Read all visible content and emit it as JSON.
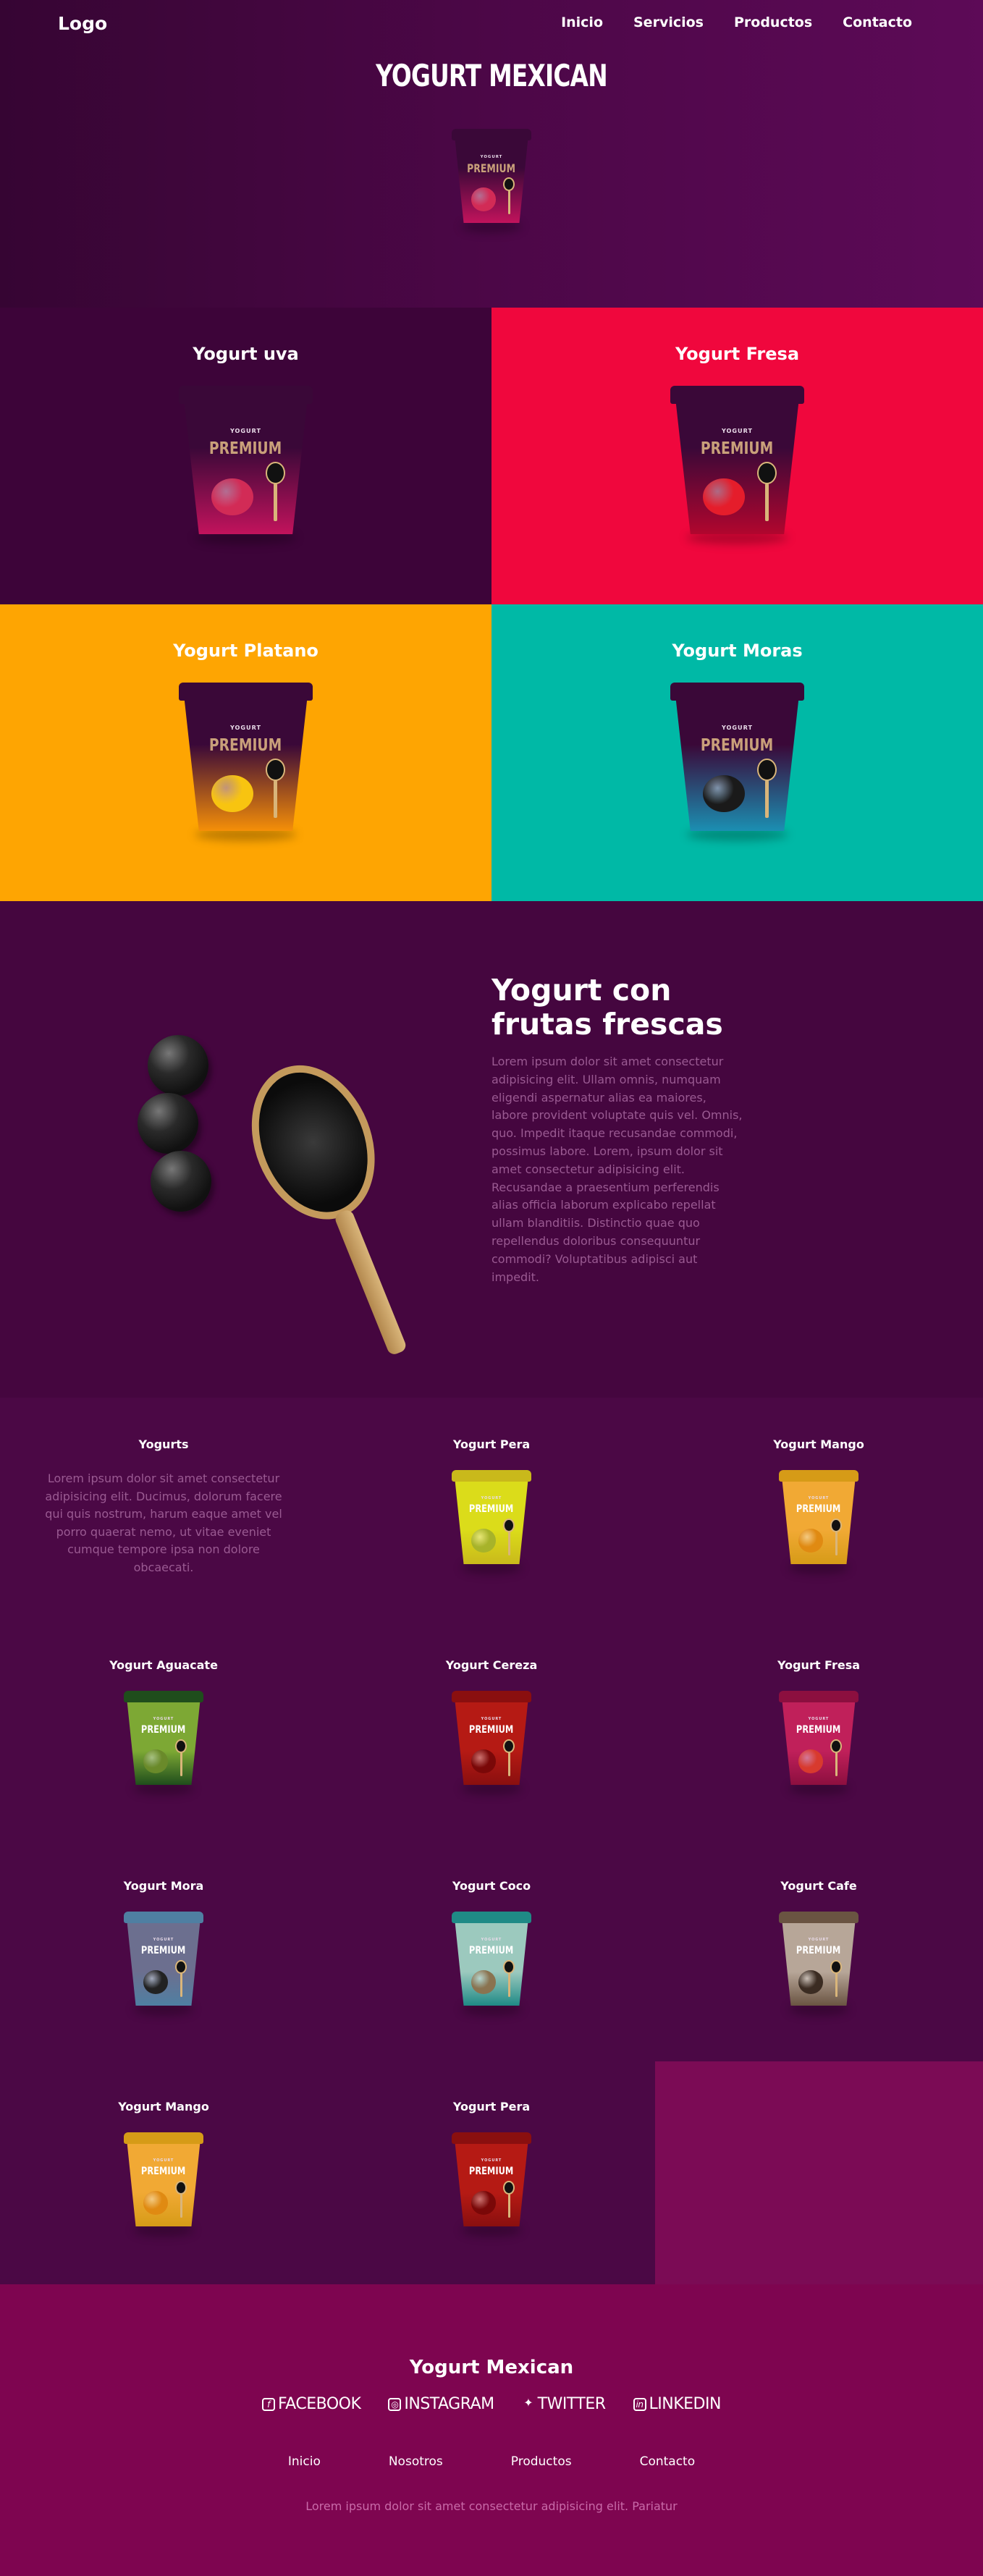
{
  "nav": {
    "logo": "Logo",
    "links": [
      "Inicio",
      "Servicios",
      "Productos",
      "Contacto"
    ]
  },
  "hero": {
    "title": "YOGURT MEXICAN",
    "cup": {
      "brand": "YOGURT",
      "label": "PREMIUM",
      "fruit": "grape-icon"
    }
  },
  "features": [
    {
      "title": "Yogurt uva",
      "bg": "#3d0439",
      "cup_body": "#c2135c",
      "fruit_color": "#d22b56",
      "fruit": "grape-icon"
    },
    {
      "title": "Yogurt Fresa",
      "bg": "#f0073d",
      "cup_body": "#b1062e",
      "fruit_color": "#e51d2b",
      "fruit": "strawberry-icon"
    },
    {
      "title": "Yogurt Platano",
      "bg": "#fea502",
      "cup_body": "#f58f08",
      "fruit_color": "#f8c410",
      "fruit": "banana-icon"
    },
    {
      "title": "Yogurt Moras",
      "bg": "#00b9a6",
      "cup_body": "#1b8fb2",
      "fruit_color": "#1a1a1a",
      "fruit": "blackberry-icon"
    }
  ],
  "cup_labels": {
    "brand": "YOGURT",
    "premium": "PREMIUM"
  },
  "about": {
    "title": "Yogurt con frutas frescas",
    "body": "Lorem ipsum dolor sit amet consectetur adipisicing elit. Ullam omnis, numquam eligendi aspernatur alias ea maiores, labore provident voluptate quis vel. Omnis, quo. Impedit itaque recusandae commodi, possimus labore. Lorem, ipsum dolor sit amet consectetur adipisicing elit. Recusandae a praesentium perferendis alias officia laborum explicabo repellat ullam blanditiis. Distinctio quae quo repellendus doloribus consequuntur commodi? Voluptatibus adipisci aut impedit."
  },
  "products": {
    "intro_title": "Yogurts",
    "intro_text": "Lorem ipsum dolor sit amet consectetur adipisicing elit. Ducimus, dolorum facere qui quis nostrum, harum eaque amet vel porro quaerat nemo, ut vitae eveniet cumque tempore ipsa non dolore obcaecati.",
    "items": [
      {
        "name": "Yogurt Pera",
        "lid": "#c9b91b",
        "body": "#dbdc1a",
        "fruit": "#a7b32a"
      },
      {
        "name": "Yogurt Mango",
        "lid": "#d69b17",
        "body": "#f1a934",
        "fruit": "#e08a12"
      },
      {
        "name": "Yogurt Aguacate",
        "lid": "#1f4d1c",
        "body": "#7da834",
        "fruit": "#6a8a2a"
      },
      {
        "name": "Yogurt Cereza",
        "lid": "#8a0f0f",
        "body": "#b51a14",
        "fruit": "#7a0808"
      },
      {
        "name": "Yogurt Fresa",
        "lid": "#8c0f3f",
        "body": "#c0205a",
        "fruit": "#d83a2e"
      },
      {
        "name": "Yogurt Mora",
        "lid": "#4f7fa2",
        "body": "#6c6f8f",
        "fruit": "#222222"
      },
      {
        "name": "Yogurt Coco",
        "lid": "#1f8a86",
        "body": "#9cc9be",
        "fruit": "#8a7350"
      },
      {
        "name": "Yogurt Cafe",
        "lid": "#6a5442",
        "body": "#b7a698",
        "fruit": "#3b2c22"
      },
      {
        "name": "Yogurt Mango",
        "lid": "#d69b17",
        "body": "#f1a934",
        "fruit": "#e08a12"
      },
      {
        "name": "Yogurt Pera",
        "lid": "#8a0f0f",
        "body": "#b51a14",
        "fruit": "#7a0808"
      }
    ]
  },
  "footer": {
    "title": "Yogurt Mexican",
    "social": [
      "FACEBOOK",
      "INSTAGRAM",
      "TWITTER",
      "LINKEDIN"
    ],
    "social_icons": [
      "facebook-icon",
      "instagram-icon",
      "twitter-icon",
      "linkedin-icon"
    ],
    "links": [
      "Inicio",
      "Nosotros",
      "Productos",
      "Contacto"
    ],
    "text": "Lorem ipsum dolor sit amet consectetur adipisicing elit. Pariatur"
  }
}
